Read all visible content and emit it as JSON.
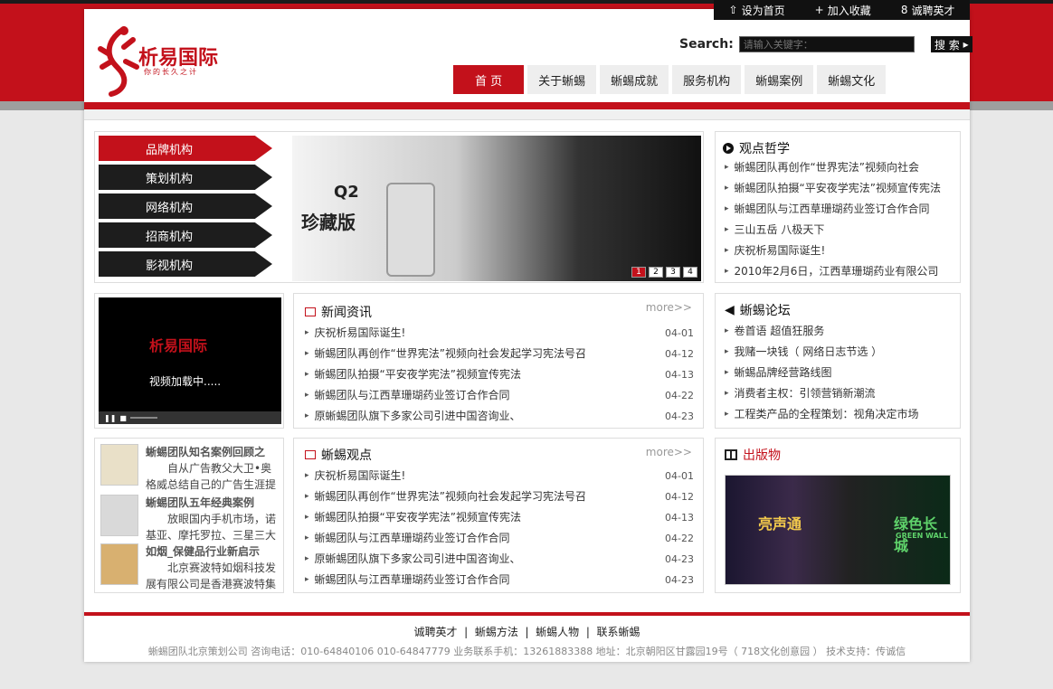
{
  "topbar": {
    "set_home": "设为首页",
    "add_fav": "加入收藏",
    "recruit": "诚聘英才"
  },
  "search": {
    "label": "Search:",
    "placeholder": "请输入关键字：",
    "button": "搜 索"
  },
  "logo": {
    "title": "析易国际",
    "tagline": "你的长久之计"
  },
  "nav": [
    "首 页",
    "关于蜥蜴",
    "蜥蜴成就",
    "服务机构",
    "蜥蜴案例",
    "蜥蜴文化"
  ],
  "side_menu": [
    "品牌机构",
    "策划机构",
    "网络机构",
    "招商机构",
    "影视机构"
  ],
  "banner": {
    "product": "Q2",
    "caption": "珍藏版",
    "pages": [
      "1",
      "2",
      "3",
      "4"
    ]
  },
  "philosophy": {
    "title": "观点哲学",
    "items": [
      "蜥蜴团队再创作“世界宪法”视频向社会",
      "蜥蜴团队拍摄“平安夜学宪法”视频宣传宪法",
      "蜥蜴团队与江西草珊瑚药业签订合作合同",
      "三山五岳 八极天下",
      "庆祝析易国际诞生!",
      "2010年2月6日，江西草珊瑚药业有限公司"
    ]
  },
  "video": {
    "logo": "析易国际",
    "loading": "视频加载中....."
  },
  "news": {
    "title": "新闻资讯",
    "more": "more>>",
    "items": [
      {
        "text": "庆祝析易国际诞生!",
        "date": "04-01"
      },
      {
        "text": "蜥蜴团队再创作“世界宪法”视频向社会发起学习宪法号召",
        "date": "04-12"
      },
      {
        "text": "蜥蜴团队拍摄“平安夜学宪法”视频宣传宪法",
        "date": "04-13"
      },
      {
        "text": "蜥蜴团队与江西草珊瑚药业签订合作合同",
        "date": "04-22"
      },
      {
        "text": "原蜥蜴团队旗下多家公司引进中国咨询业、",
        "date": "04-23"
      }
    ]
  },
  "forum": {
    "title": "蜥蜴论坛",
    "items": [
      "卷首语 超值狂服务",
      "我赌一块钱（ 网络日志节选 ）",
      "蜥蜴品牌经营路线图",
      "消费者主权：引领营销新潮流",
      "工程类产品的全程策划：视角决定市场"
    ]
  },
  "cases": [
    {
      "title": "蜥蜴团队知名案例回顾之",
      "desc": "自从广告教父大卫•奥格威总结自己的广告生涯提"
    },
    {
      "title": "蜥蜴团队五年经典案例",
      "desc": "放眼国内手机市场，诺基亚、摩托罗拉、三星三大"
    },
    {
      "title": "如烟_保健品行业新启示",
      "desc": "北京赛波特如烟科技发展有限公司是香港赛波特集"
    }
  ],
  "views": {
    "title": "蜥蜴观点",
    "more": "more>>",
    "items": [
      {
        "text": "庆祝析易国际诞生!",
        "date": "04-01"
      },
      {
        "text": "蜥蜴团队再创作“世界宪法”视频向社会发起学习宪法号召",
        "date": "04-12"
      },
      {
        "text": "蜥蜴团队拍摄“平安夜学宪法”视频宣传宪法",
        "date": "04-13"
      },
      {
        "text": "蜥蜴团队与江西草珊瑚药业签订合作合同",
        "date": "04-22"
      },
      {
        "text": "原蜥蜴团队旗下多家公司引进中国咨询业、",
        "date": "04-23"
      },
      {
        "text": "蜥蜴团队与江西草珊瑚药业签订合作合同",
        "date": "04-23"
      }
    ]
  },
  "publications": {
    "title": "出版物",
    "image_text1": "亮声通",
    "image_text2": "绿色长城",
    "image_text3": "GREEN WALL"
  },
  "footer": {
    "links": [
      "诚聘英才",
      "蜥蜴方法",
      "蜥蜴人物",
      "联系蜥蜴"
    ],
    "info": "蜥蜴团队北京策划公司   咨询电话：010-64840106  010-64847779   业务联系手机：13261883388   地址：北京朝阳区甘露园19号（ 718文化创意园 ）   技术支持：传诚信"
  }
}
